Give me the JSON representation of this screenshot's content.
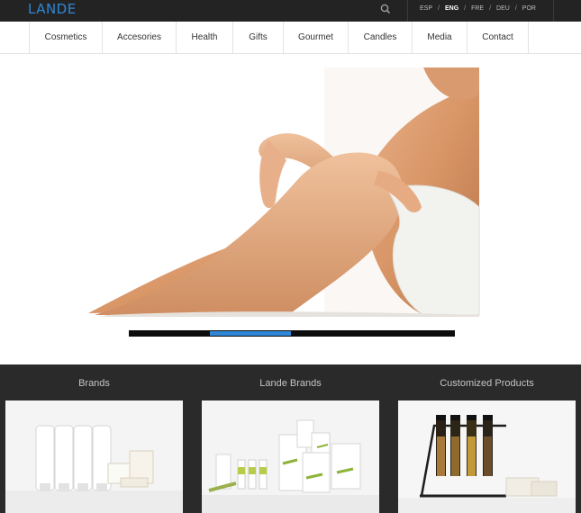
{
  "header": {
    "logo_text": "LANDE",
    "search_icon": "search-icon",
    "languages": [
      {
        "label": "ESP",
        "active": false
      },
      {
        "label": "ENG",
        "active": true
      },
      {
        "label": "FRE",
        "active": false
      },
      {
        "label": "DEU",
        "active": false
      },
      {
        "label": "POR",
        "active": false
      }
    ],
    "language_separator": "/"
  },
  "nav": {
    "items": [
      "Cosmetics",
      "Accesories",
      "Health",
      "Gifts",
      "Gourmet",
      "Candles",
      "Media",
      "Contact"
    ]
  },
  "hero": {
    "image": "woman-in-towel-photo",
    "slider_progress": 0.25
  },
  "sections": [
    {
      "title": "Brands",
      "image": "white-tubes-and-soaps-photo"
    },
    {
      "title": "Lande Brands",
      "image": "pure-amenities-photo"
    },
    {
      "title": "Customized Products",
      "image": "bottle-rack-photo"
    }
  ],
  "colors": {
    "accent": "#2f86d6",
    "topbar": "#232323",
    "footer": "#2a2a2a"
  }
}
